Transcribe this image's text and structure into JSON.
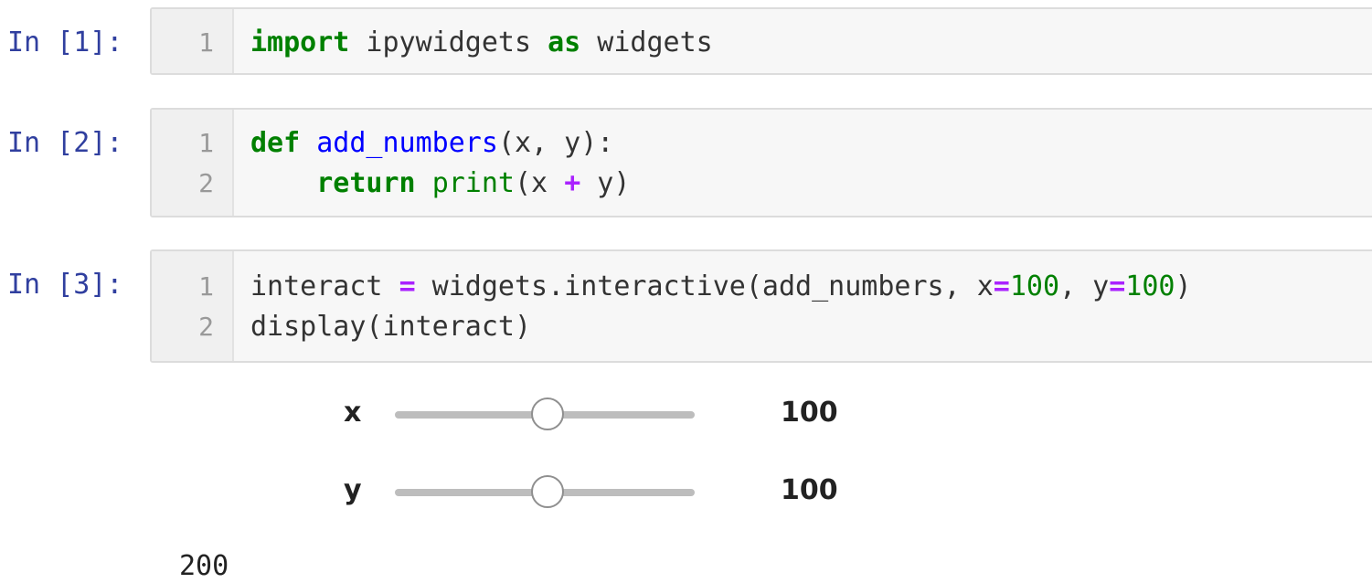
{
  "cells": [
    {
      "prompt": "In [1]:",
      "lines": [
        {
          "n": "1",
          "tokens": [
            [
              "import",
              "kw"
            ],
            [
              " ipywidgets ",
              ""
            ],
            [
              "as",
              "kw"
            ],
            [
              " widgets",
              ""
            ]
          ]
        }
      ]
    },
    {
      "prompt": "In [2]:",
      "lines": [
        {
          "n": "1",
          "tokens": [
            [
              "def",
              "kw"
            ],
            [
              " ",
              ""
            ],
            [
              "add_numbers",
              "fn"
            ],
            [
              "(x, y):",
              ""
            ]
          ]
        },
        {
          "n": "2",
          "tokens": [
            [
              "    ",
              ""
            ],
            [
              "return",
              "kw"
            ],
            [
              " ",
              ""
            ],
            [
              "print",
              "bi"
            ],
            [
              "(x ",
              ""
            ],
            [
              "+",
              "op"
            ],
            [
              " y)",
              ""
            ]
          ]
        }
      ]
    },
    {
      "prompt": "In [3]:",
      "lines": [
        {
          "n": "1",
          "tokens": [
            [
              "interact ",
              ""
            ],
            [
              "=",
              "op"
            ],
            [
              " widgets.interactive(add_numbers, x",
              ""
            ],
            [
              "=",
              "op"
            ],
            [
              "100",
              "num"
            ],
            [
              ", y",
              ""
            ],
            [
              "=",
              "op"
            ],
            [
              "100",
              "num"
            ],
            [
              ")",
              ""
            ]
          ]
        },
        {
          "n": "2",
          "tokens": [
            [
              "display(interact)",
              ""
            ]
          ]
        }
      ]
    }
  ],
  "widgets": [
    {
      "label": "x",
      "value": "100",
      "fraction": 0.51
    },
    {
      "label": "y",
      "value": "100",
      "fraction": 0.51
    }
  ],
  "output": "200"
}
